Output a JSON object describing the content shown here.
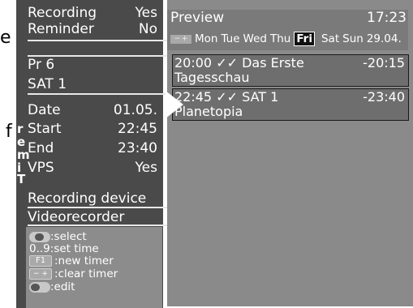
{
  "outside": {
    "top_letter": "e",
    "mid_letter": "f"
  },
  "timer": {
    "recording_label": "Recording",
    "recording_value": "Yes",
    "reminder_label": "Reminder",
    "reminder_value": "No",
    "programme": "Pr  6",
    "channel": "SAT 1",
    "date_label": "Date",
    "date_value": "01.05.",
    "start_label": "Start",
    "start_value": "22:45",
    "end_label": "End",
    "end_value": "23:40",
    "vps_label": "VPS",
    "vps_value": "Yes",
    "vertical_title": [
      "T",
      "i",
      "m",
      "e",
      "r"
    ],
    "recording_device_label": "Recording device",
    "recording_device_value": "Videorecorder"
  },
  "help": {
    "select": ":select",
    "set_time_key": "0..9",
    "set_time": ":set time",
    "f1_key": "F1",
    "new_timer": ":new timer",
    "clear_key": "−  +",
    "clear_timer": ":clear timer",
    "edit": ":edit"
  },
  "preview": {
    "title": "Preview",
    "clock": "17:23",
    "minus_plus": "−  +",
    "days": [
      "Mon",
      "Tue",
      "Wed",
      "Thu",
      "Fri",
      "Sat",
      "Sun"
    ],
    "active_day": "Fri",
    "date": "29.04.",
    "entries": [
      {
        "start": "20:00",
        "checks": "✓✓",
        "channel": "Das Erste",
        "end": "-20:15",
        "title": "Tagesschau"
      },
      {
        "start": "22:45",
        "checks": "✓✓",
        "channel": "SAT 1",
        "end": "-23:40",
        "title": "Planetopia"
      }
    ]
  }
}
